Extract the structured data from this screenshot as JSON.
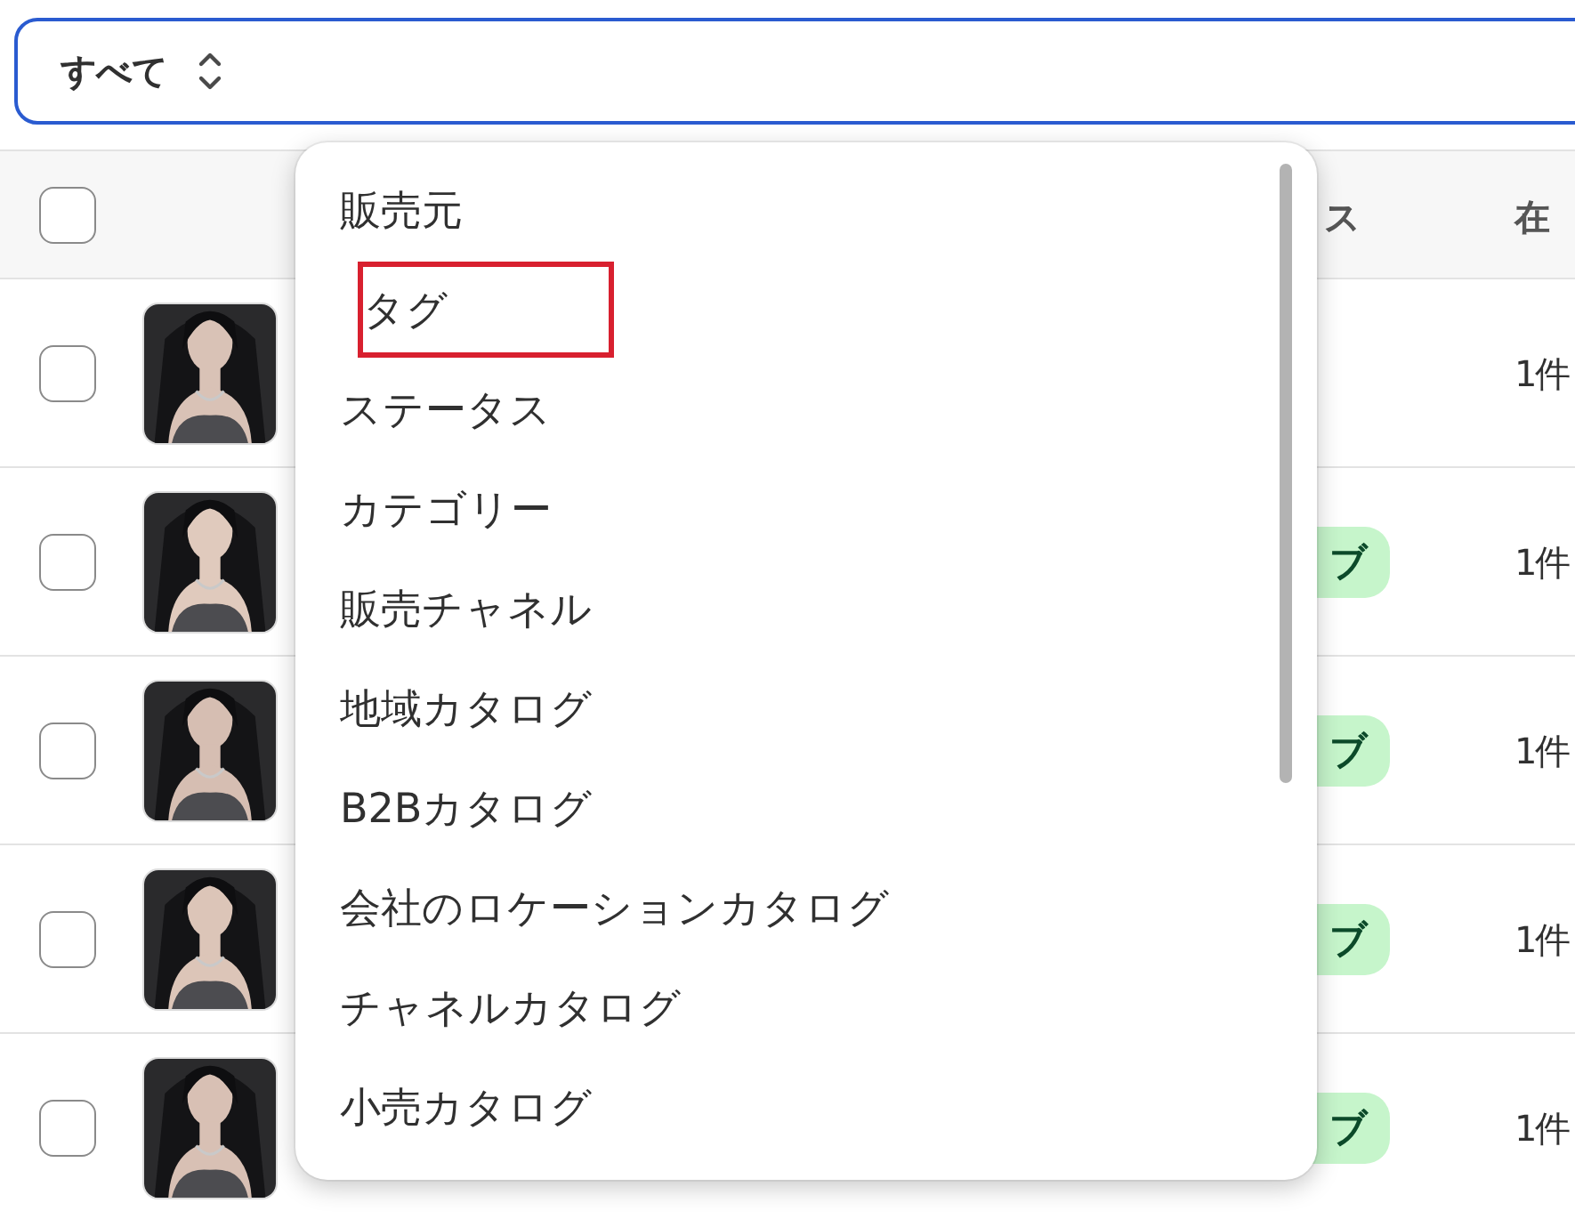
{
  "filter": {
    "value": "すべて"
  },
  "table": {
    "columns": [
      {
        "label": "ス"
      },
      {
        "label": "在"
      }
    ],
    "header_checkbox": {
      "checked": false
    },
    "rows": [
      {
        "checked": false,
        "status": null,
        "stock": "1件"
      },
      {
        "checked": false,
        "status": "ブ",
        "stock": "1件"
      },
      {
        "checked": false,
        "status": "ブ",
        "stock": "1件"
      },
      {
        "checked": false,
        "status": "ブ",
        "stock": "1件"
      },
      {
        "checked": false,
        "status": "ブ",
        "stock": "1件"
      }
    ]
  },
  "menu": {
    "items": [
      {
        "label": "販売元",
        "highlighted": false
      },
      {
        "label": "タグ",
        "highlighted": true
      },
      {
        "label": "ステータス",
        "highlighted": false
      },
      {
        "label": "カテゴリー",
        "highlighted": false
      },
      {
        "label": "販売チャネル",
        "highlighted": false
      },
      {
        "label": "地域カタログ",
        "highlighted": false
      },
      {
        "label": "B2Bカタログ",
        "highlighted": false
      },
      {
        "label": "会社のロケーションカタログ",
        "highlighted": false
      },
      {
        "label": "チャネルカタログ",
        "highlighted": false
      },
      {
        "label": "小売カタログ",
        "highlighted": false
      }
    ]
  }
}
